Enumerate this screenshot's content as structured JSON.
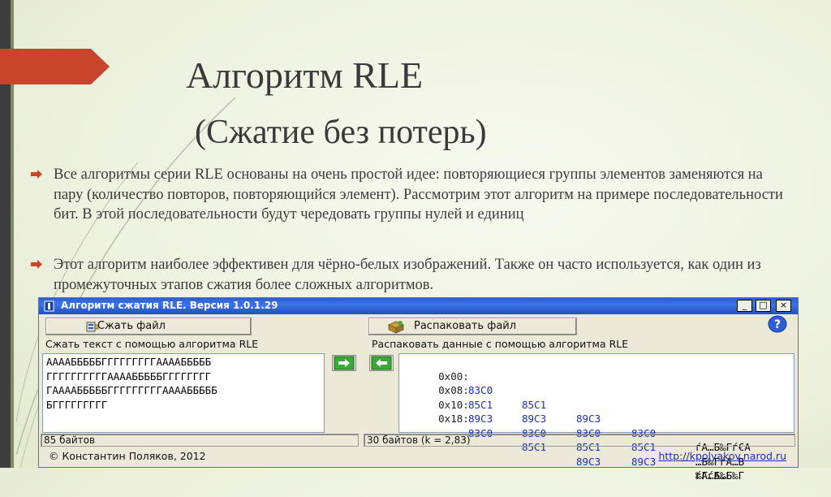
{
  "slide": {
    "title": "Алгоритм RLE",
    "subtitle": "(Сжатие без потерь)",
    "bullets": [
      "Все алгоритмы серии RLE основаны на очень простой идее: повторяющиеся группы элементов заменяются на пару (количество повторов, повторяющийся элемент). Рассмотрим этот алгоритм на примере последовательности бит. В этой последовательности будут чередовать группы нулей и единиц",
      "Этот алгоритм наиболее эффективен для чёрно-белых изображений. Также он часто используется, как один из промежуточных этапов сжатия более сложных алгоритмов."
    ],
    "accent_color": "#c8442a"
  },
  "window": {
    "title": "Алгоритм сжатия RLE. Версия 1.0.1.29",
    "controls": {
      "minimize": "_",
      "maximize": "□",
      "close": "×"
    },
    "compress_button": "Сжать файл",
    "unpack_button": "Распаковать файл",
    "left_label": "Сжать текст с помощью алгоритма RLE",
    "right_label": "Распаковать данные с помощью алгоритма RLE",
    "left_lines": [
      "ААААБББББГГГГГГГГГААААБББББ",
      "ГГГГГГГГГГААААБББББГГГГГГГГ",
      "ГААААБББББГГГГГГГГГААААБББББ",
      "БГГГГГГГГГ"
    ],
    "hex_rows": [
      {
        "addr": "0x00:",
        "hex": [
          "83C0",
          "85C1",
          "89C3",
          "83C0"
        ],
        "ascii": "ѓА…Б‰Гѓ€А"
      },
      {
        "addr": "0x08:",
        "hex": [
          "85C1",
          "89C3",
          "83C0",
          "85C1"
        ],
        "ascii": "…Б‰ГѓА…В"
      },
      {
        "addr": "0x10:",
        "hex": [
          "89C3",
          "83C0",
          "85C1",
          "89C3"
        ],
        "ascii": "‰ГѓА…Б‰Г"
      },
      {
        "addr": "0x18:",
        "hex": [
          "83C0",
          "85C1",
          "89C3"
        ],
        "ascii": "ѓА…Б‰Г"
      }
    ],
    "left_status": "85 байтов",
    "right_status": "30 байтов (k = 2,83)",
    "copyright": "© Константин Поляков, 2012",
    "link": "http://kpolyakov.narod.ru",
    "help_icon": "help-icon"
  }
}
